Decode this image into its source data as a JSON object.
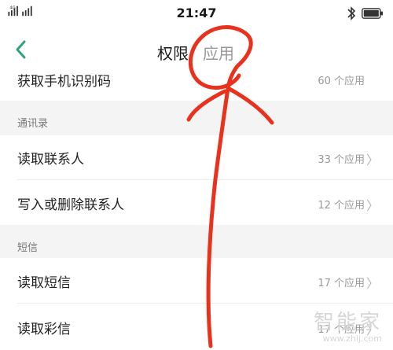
{
  "status_bar": {
    "network_label": "4G",
    "time": "21:47"
  },
  "header": {
    "tabs": [
      {
        "label": "权限",
        "active": true
      },
      {
        "label": "应用",
        "active": false
      }
    ]
  },
  "list": {
    "top_partial": {
      "title": "获取手机识别码",
      "count": "60 个应用"
    },
    "sections": [
      {
        "header": "通讯录",
        "items": [
          {
            "title": "读取联系人",
            "count": "33 个应用"
          },
          {
            "title": "写入或删除联系人",
            "count": "12 个应用"
          }
        ]
      },
      {
        "header": "短信",
        "items": [
          {
            "title": "读取短信",
            "count": "17 个应用"
          },
          {
            "title": "读取彩信",
            "count": "17 个应用"
          }
        ]
      }
    ],
    "chevron": "〉"
  },
  "watermark": {
    "text": "智能家",
    "url": "www.zhij.com"
  },
  "colors": {
    "accent": "#2fa37a",
    "annotation": "#e8321e",
    "section_bg": "#f4f4f4"
  }
}
